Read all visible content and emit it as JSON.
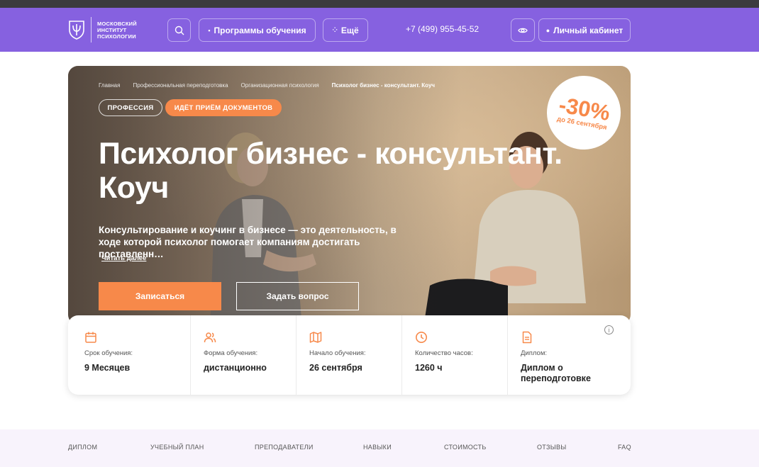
{
  "logo": {
    "text": "московский институт психологии"
  },
  "header": {
    "programs_label": "Программы обучения",
    "more_label": "Ещё",
    "phone": "+7 (499) 955-45-52",
    "cabinet_label": "Личный кабинет"
  },
  "breadcrumb": [
    "Главная",
    "Профессиональная переподготовка",
    "Организационная психология",
    "Психолог бизнес - консультант. Коуч"
  ],
  "tags": {
    "profession": "ПРОФЕССИЯ",
    "admission": "ИДЁТ ПРИЁМ ДОКУМЕНТОВ"
  },
  "discount": {
    "percent": "-30%",
    "until": "до 26 сентября"
  },
  "hero": {
    "title": "Психолог бизнес - консультант. Коуч",
    "description": "Консультирование и коучинг в бизнесе — это деятельность, в ходе которой психолог помогает компаниям достигать поставленн…",
    "read_more": "Читать далее",
    "enroll_label": "Записаться",
    "ask_label": "Задать вопрос"
  },
  "info": [
    {
      "icon": "calendar-icon",
      "label": "Срок обучения:",
      "value": "9 Месяцев"
    },
    {
      "icon": "users-icon",
      "label": "Форма обучения:",
      "value": "дистанционно"
    },
    {
      "icon": "map-icon",
      "label": "Начало обучения:",
      "value": "26 сентября"
    },
    {
      "icon": "clock-icon",
      "label": "Количество часов:",
      "value": "1260 ч"
    },
    {
      "icon": "document-icon",
      "label": "Диплом:",
      "value": "Диплом о переподготовке"
    }
  ],
  "footer_nav": [
    "ДИПЛОМ",
    "УЧЕБНЫЙ ПЛАН",
    "ПРЕПОДАВАТЕЛИ",
    "НАВЫКИ",
    "СТОИМОСТЬ",
    "ОТЗЫВЫ",
    "FAQ"
  ],
  "colors": {
    "header": "#8661e0",
    "accent": "#f7894a",
    "nav_bg": "#f8f3fc"
  }
}
